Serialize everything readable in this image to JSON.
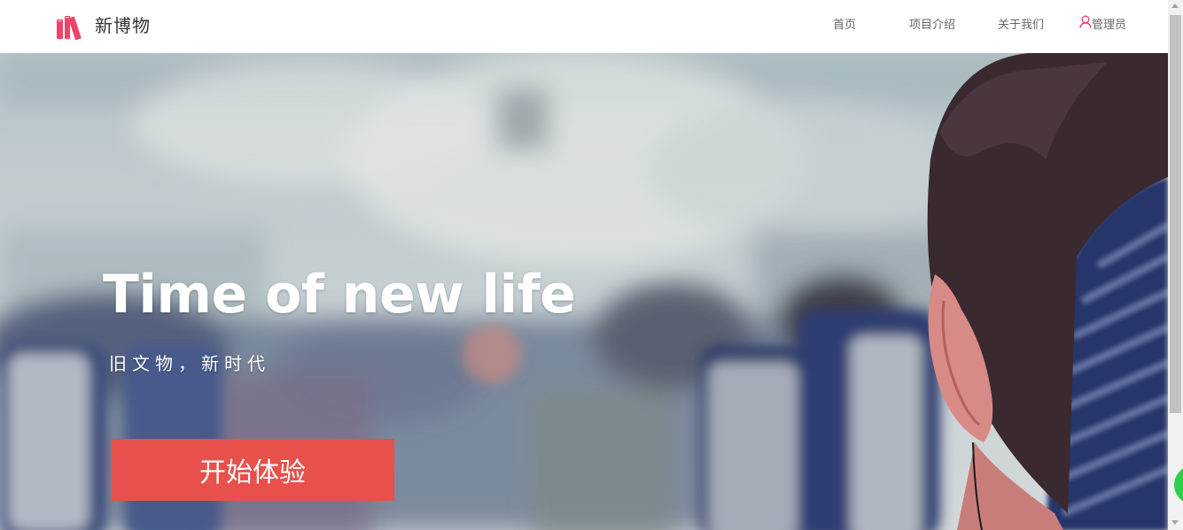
{
  "header": {
    "brand_name": "新博物",
    "nav": {
      "home": "首页",
      "project": "项目介绍",
      "about": "关于我们",
      "admin": "管理员"
    }
  },
  "hero": {
    "title": "Time of new life",
    "subtitle": "旧文物，新时代",
    "cta_label": "开始体验"
  },
  "icons": {
    "logo": "books-logo-icon",
    "admin": "user-icon"
  },
  "colors": {
    "accent": "#e8504b",
    "logo": "#f0426a",
    "admin_icon": "#f0426a",
    "nav_text": "#666666"
  }
}
